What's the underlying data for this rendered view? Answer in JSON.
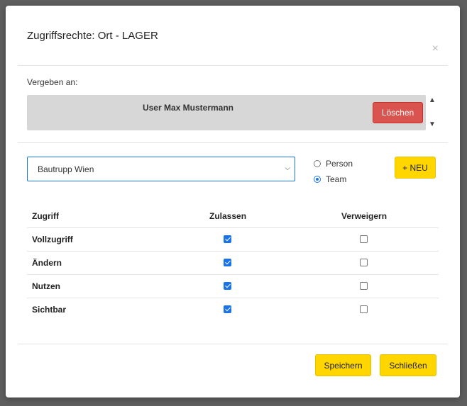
{
  "modal": {
    "title": "Zugriffsrechte: Ort - LAGER",
    "close_label": "×"
  },
  "assign": {
    "label": "Vergeben an:",
    "entry": "User Max Mustermann",
    "delete_label": "Löschen"
  },
  "selector": {
    "selected_value": "Bautrupp Wien",
    "options": [
      {
        "label": "Person",
        "checked": false
      },
      {
        "label": "Team",
        "checked": true
      }
    ],
    "new_label": "+ NEU"
  },
  "permissions": {
    "headers": [
      "Zugriff",
      "Zulassen",
      "Verweigern"
    ],
    "rows": [
      {
        "label": "Vollzugriff",
        "allow": true,
        "deny": false
      },
      {
        "label": "Ändern",
        "allow": true,
        "deny": false
      },
      {
        "label": "Nutzen",
        "allow": true,
        "deny": false
      },
      {
        "label": "Sichtbar",
        "allow": true,
        "deny": false
      }
    ]
  },
  "footer": {
    "save_label": "Speichern",
    "close_label": "Schließen"
  },
  "colors": {
    "accent_yellow": "#ffd600",
    "danger_red": "#d9534f",
    "focus_blue": "#1a73e8"
  }
}
